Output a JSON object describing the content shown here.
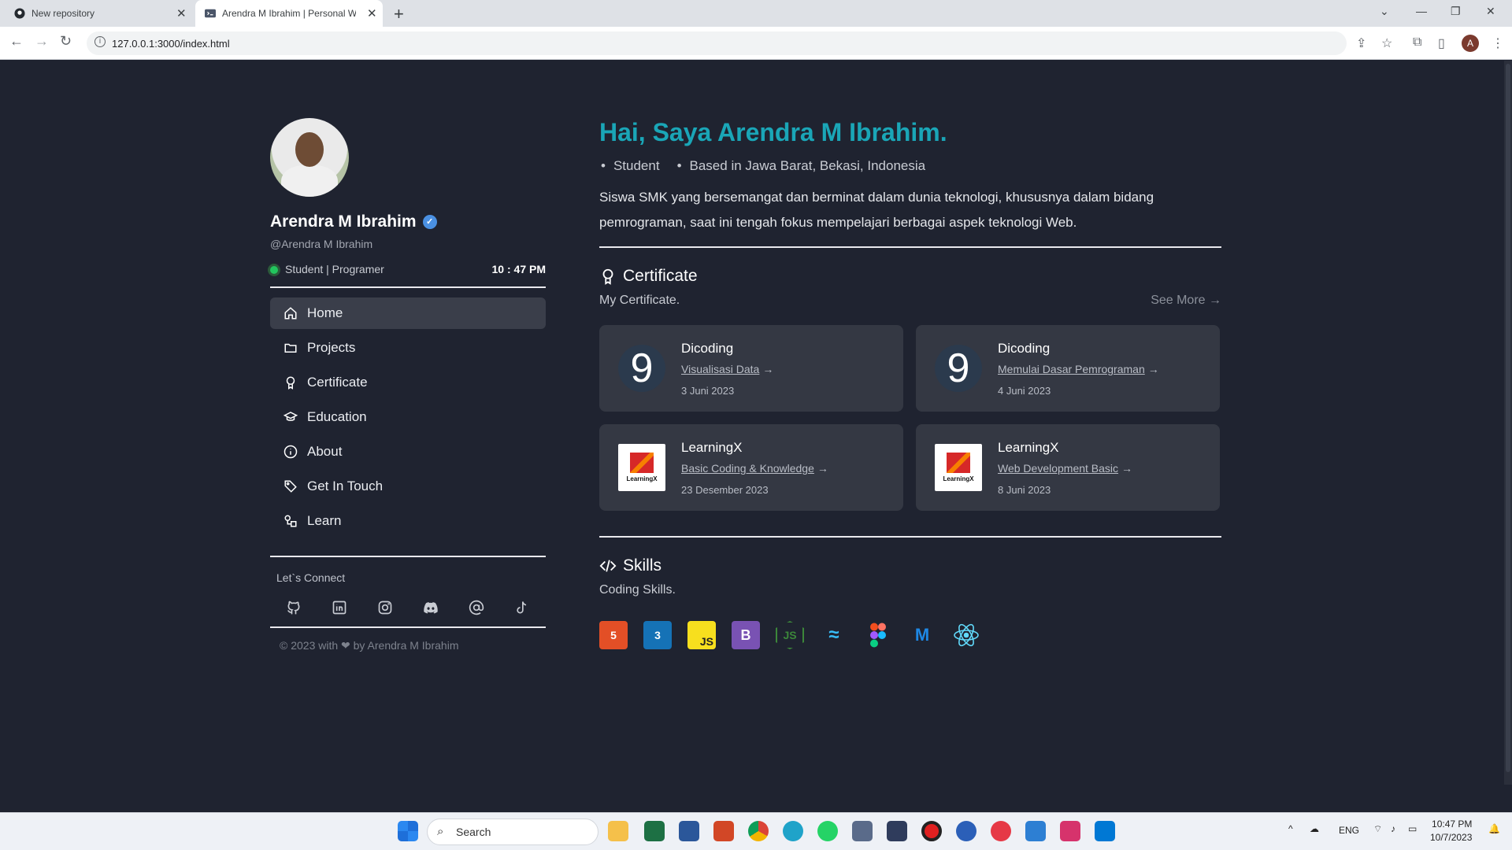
{
  "browser": {
    "tabs": [
      {
        "title": "New repository",
        "icon": "github-icon"
      },
      {
        "title": "Arendra M Ibrahim | Personal W",
        "icon": "code-icon"
      }
    ],
    "url": "127.0.0.1:3000/index.html",
    "profile_initial": "A"
  },
  "sidebar": {
    "name": "Arendra M Ibrahim",
    "handle": "@Arendra M Ibrahim",
    "status": "Student | Programer",
    "clock": "10 : 47 PM",
    "nav": [
      {
        "label": "Home",
        "icon": "home-icon"
      },
      {
        "label": "Projects",
        "icon": "folder-icon"
      },
      {
        "label": "Certificate",
        "icon": "award-icon"
      },
      {
        "label": "Education",
        "icon": "graduation-cap-icon"
      },
      {
        "label": "About",
        "icon": "info-icon"
      },
      {
        "label": "Get In Touch",
        "icon": "tag-icon"
      },
      {
        "label": "Learn",
        "icon": "shapes-icon"
      }
    ],
    "connect_label": "Let`s Connect",
    "social": [
      "github-icon",
      "linkedin-icon",
      "instagram-icon",
      "discord-icon",
      "at-icon",
      "tiktok-icon"
    ],
    "footer": "© 2023 with ❤ by Arendra M Ibrahim"
  },
  "main": {
    "greeting": "Hai, Saya Arendra M Ibrahim.",
    "tags": [
      "Student",
      "Based in Jawa Barat, Bekasi, Indonesia"
    ],
    "bio": "Siswa SMK yang bersemangat dan berminat dalam dunia teknologi, khususnya dalam bidang pemrograman, saat ini tengah fokus mempelajari berbagai aspek teknologi Web.",
    "certificate": {
      "heading": "Certificate",
      "sub": "My Certificate.",
      "see_more": "See More →",
      "items": [
        {
          "issuer": "Dicoding",
          "title": "Visualisasi Data",
          "date": "3 Juni 2023",
          "logo": "dicoding"
        },
        {
          "issuer": "Dicoding",
          "title": "Memulai Dasar Pemrograman",
          "date": "4 Juni 2023",
          "logo": "dicoding"
        },
        {
          "issuer": "LearningX",
          "title": "Basic Coding & Knowledge",
          "date": "23 Desember 2023",
          "logo": "learningx"
        },
        {
          "issuer": "LearningX",
          "title": "Web Development Basic",
          "date": "8 Juni 2023",
          "logo": "learningx"
        }
      ]
    },
    "skills": {
      "heading": "Skills",
      "sub": "Coding Skills.",
      "icons": [
        {
          "name": "html5-icon",
          "color": "#e34f26"
        },
        {
          "name": "css3-icon",
          "color": "#1572b6"
        },
        {
          "name": "javascript-icon",
          "color": "#f7df1e"
        },
        {
          "name": "bootstrap-icon",
          "color": "#7952b3"
        },
        {
          "name": "nodejs-icon",
          "color": "#3c873a"
        },
        {
          "name": "tailwind-icon",
          "color": "#38bdf8"
        },
        {
          "name": "figma-icon",
          "color": "#a259ff"
        },
        {
          "name": "mui-icon",
          "color": "#1e88e5"
        },
        {
          "name": "react-icon",
          "color": "#61dafb"
        }
      ]
    }
  },
  "taskbar": {
    "search_label": "Search",
    "lang": "ENG",
    "time": "10:47 PM",
    "date": "10/7/2023"
  },
  "colors": {
    "accent": "#1aa6b7",
    "background": "#1f2330",
    "card": "#343843"
  }
}
